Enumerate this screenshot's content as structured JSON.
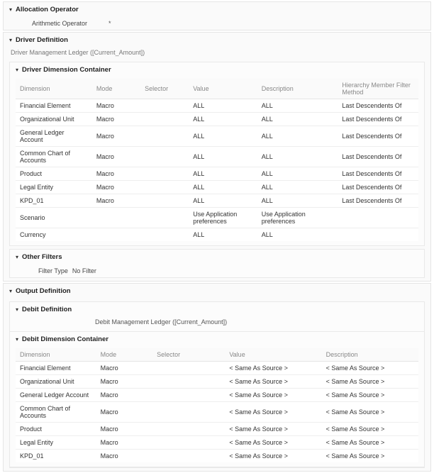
{
  "allocationOperator": {
    "title": "Allocation Operator",
    "fieldLabel": "Arithmetic Operator",
    "fieldValue": "*"
  },
  "driverDefinition": {
    "title": "Driver Definition",
    "subtext": "Driver Management Ledger ([Current_Amount])",
    "container": {
      "title": "Driver Dimension Container",
      "headers": {
        "dimension": "Dimension",
        "mode": "Mode",
        "selector": "Selector",
        "value": "Value",
        "description": "Description",
        "hmfm": "Hierarchy Member Filter Method"
      },
      "rows": [
        {
          "dimension": "Financial Element",
          "mode": "Macro",
          "selector": "",
          "value": "ALL",
          "description": "ALL",
          "hmfm": "Last Descendents Of"
        },
        {
          "dimension": "Organizational Unit",
          "mode": "Macro",
          "selector": "",
          "value": "ALL",
          "description": "ALL",
          "hmfm": "Last Descendents Of"
        },
        {
          "dimension": "General Ledger Account",
          "mode": "Macro",
          "selector": "",
          "value": "ALL",
          "description": "ALL",
          "hmfm": "Last Descendents Of"
        },
        {
          "dimension": "Common Chart of Accounts",
          "mode": "Macro",
          "selector": "",
          "value": "ALL",
          "description": "ALL",
          "hmfm": "Last Descendents Of"
        },
        {
          "dimension": "Product",
          "mode": "Macro",
          "selector": "",
          "value": "ALL",
          "description": "ALL",
          "hmfm": "Last Descendents Of"
        },
        {
          "dimension": "Legal Entity",
          "mode": "Macro",
          "selector": "",
          "value": "ALL",
          "description": "ALL",
          "hmfm": "Last Descendents Of"
        },
        {
          "dimension": "KPD_01",
          "mode": "Macro",
          "selector": "",
          "value": "ALL",
          "description": "ALL",
          "hmfm": "Last Descendents Of"
        },
        {
          "dimension": "Scenario",
          "mode": "",
          "selector": "",
          "value": "Use Application preferences",
          "description": "Use Application preferences",
          "hmfm": ""
        },
        {
          "dimension": "Currency",
          "mode": "",
          "selector": "",
          "value": "ALL",
          "description": "ALL",
          "hmfm": ""
        }
      ]
    },
    "otherFilters": {
      "title": "Other Filters",
      "label": "Filter Type",
      "value": "No Filter"
    }
  },
  "outputDefinition": {
    "title": "Output Definition",
    "debitDefinition": {
      "title": "Debit Definition",
      "subtext": "Debit  Management Ledger   ([Current_Amount])",
      "container": {
        "title": "Debit Dimension Container",
        "headers": {
          "dimension": "Dimension",
          "mode": "Mode",
          "selector": "Selector",
          "value": "Value",
          "description": "Description"
        },
        "rows": [
          {
            "dimension": "Financial Element",
            "mode": "Macro",
            "selector": "",
            "value": "< Same As Source >",
            "description": "< Same As Source >"
          },
          {
            "dimension": "Organizational Unit",
            "mode": "Macro",
            "selector": "",
            "value": "< Same As Source >",
            "description": "< Same As Source >"
          },
          {
            "dimension": "General Ledger Account",
            "mode": "Macro",
            "selector": "",
            "value": "< Same As Source >",
            "description": "< Same As Source >"
          },
          {
            "dimension": "Common Chart of Accounts",
            "mode": "Macro",
            "selector": "",
            "value": "< Same As Source >",
            "description": "< Same As Source >"
          },
          {
            "dimension": "Product",
            "mode": "Macro",
            "selector": "",
            "value": "< Same As Source >",
            "description": "< Same As Source >"
          },
          {
            "dimension": "Legal Entity",
            "mode": "Macro",
            "selector": "",
            "value": "< Same As Source >",
            "description": "< Same As Source >"
          },
          {
            "dimension": "KPD_01",
            "mode": "Macro",
            "selector": "",
            "value": "< Same As Source >",
            "description": "< Same As Source >"
          }
        ]
      }
    }
  }
}
